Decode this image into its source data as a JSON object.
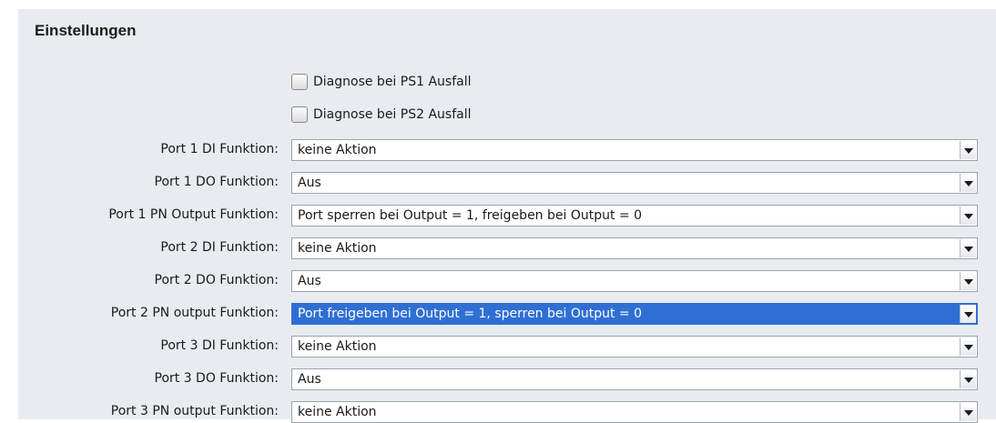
{
  "section": {
    "title": "Einstellungen"
  },
  "checkboxes": [
    {
      "label": "Diagnose bei PS1 Ausfall",
      "checked": false
    },
    {
      "label": "Diagnose bei PS2 Ausfall",
      "checked": false
    }
  ],
  "fields": [
    {
      "label": "Port 1 DI Funktion:",
      "value": "keine Aktion"
    },
    {
      "label": "Port 1 DO Funktion:",
      "value": "Aus"
    },
    {
      "label": "Port 1 PN Output Funktion:",
      "value": "Port sperren bei Output = 1, freigeben bei Output = 0"
    },
    {
      "label": "Port 2 DI Funktion:",
      "value": "keine Aktion"
    },
    {
      "label": "Port 2 DO Funktion:",
      "value": "Aus"
    },
    {
      "label": "Port 2 PN output Funktion:",
      "value": "Port freigeben bei Output = 1, sperren bei Output = 0",
      "selected": true
    },
    {
      "label": "Port 3 DI Funktion:",
      "value": "keine Aktion"
    },
    {
      "label": "Port 3 DO Funktion:",
      "value": "Aus"
    },
    {
      "label": "Port 3 PN output Funktion:",
      "value": "keine Aktion"
    }
  ],
  "colors": {
    "panel": "#e8ecf0",
    "selection": "#2f6fd4"
  },
  "icons": {
    "dropdown": "chevron-down-icon"
  }
}
